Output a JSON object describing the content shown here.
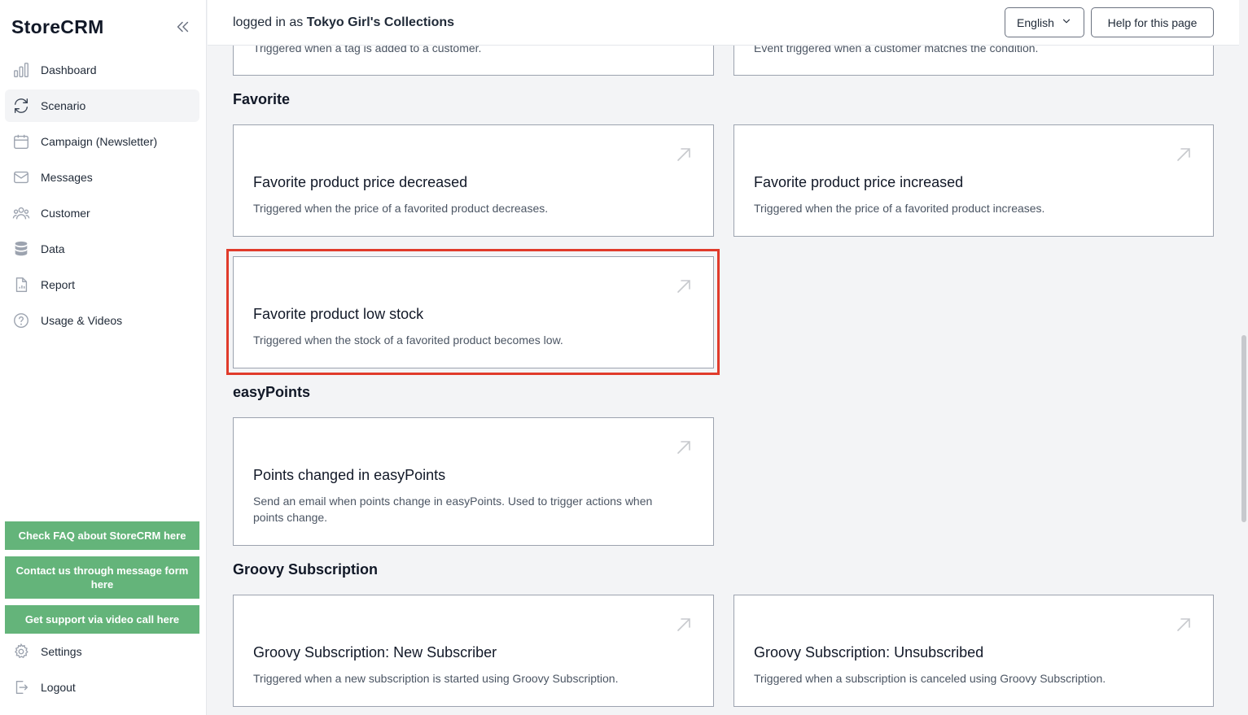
{
  "sidebar": {
    "brand": "StoreCRM",
    "items": [
      {
        "label": "Dashboard",
        "icon": "bar-chart-icon"
      },
      {
        "label": "Scenario",
        "icon": "refresh-icon"
      },
      {
        "label": "Campaign (Newsletter)",
        "icon": "calendar-icon"
      },
      {
        "label": "Messages",
        "icon": "mail-icon"
      },
      {
        "label": "Customer",
        "icon": "users-icon"
      },
      {
        "label": "Data",
        "icon": "database-icon"
      },
      {
        "label": "Report",
        "icon": "document-chart-icon"
      },
      {
        "label": "Usage & Videos",
        "icon": "question-circle-icon"
      }
    ],
    "support": {
      "faq": "Check FAQ about StoreCRM here",
      "contact": "Contact us through message form here",
      "video": "Get support via video call here"
    },
    "settings": "Settings",
    "logout": "Logout"
  },
  "header": {
    "logged_prefix": "logged in as",
    "store_name": "Tokyo Girl's Collections",
    "language": "English",
    "help": "Help for this page"
  },
  "top_cards": {
    "left_desc": "Triggered when a tag is added to a customer.",
    "right_desc": "Event triggered when a customer matches the condition."
  },
  "sections": {
    "favorite": {
      "title": "Favorite",
      "cards": [
        {
          "title": "Favorite product price decreased",
          "desc": "Triggered when the price of a favorited product decreases."
        },
        {
          "title": "Favorite product price increased",
          "desc": "Triggered when the price of a favorited product increases."
        },
        {
          "title": "Favorite product low stock",
          "desc": "Triggered when the stock of a favorited product becomes low."
        }
      ]
    },
    "easypoints": {
      "title": "easyPoints",
      "cards": [
        {
          "title": "Points changed in easyPoints",
          "desc": "Send an email when points change in easyPoints. Used to trigger actions when points change."
        }
      ]
    },
    "groovy": {
      "title": "Groovy Subscription",
      "cards": [
        {
          "title": "Groovy Subscription: New Subscriber",
          "desc": "Triggered when a new subscription is started using Groovy Subscription."
        },
        {
          "title": "Groovy Subscription: Unsubscribed",
          "desc": "Triggered when a subscription is canceled using Groovy Subscription."
        }
      ]
    }
  },
  "colors": {
    "support_button": "#64b47a",
    "highlight": "#e03b2b"
  }
}
